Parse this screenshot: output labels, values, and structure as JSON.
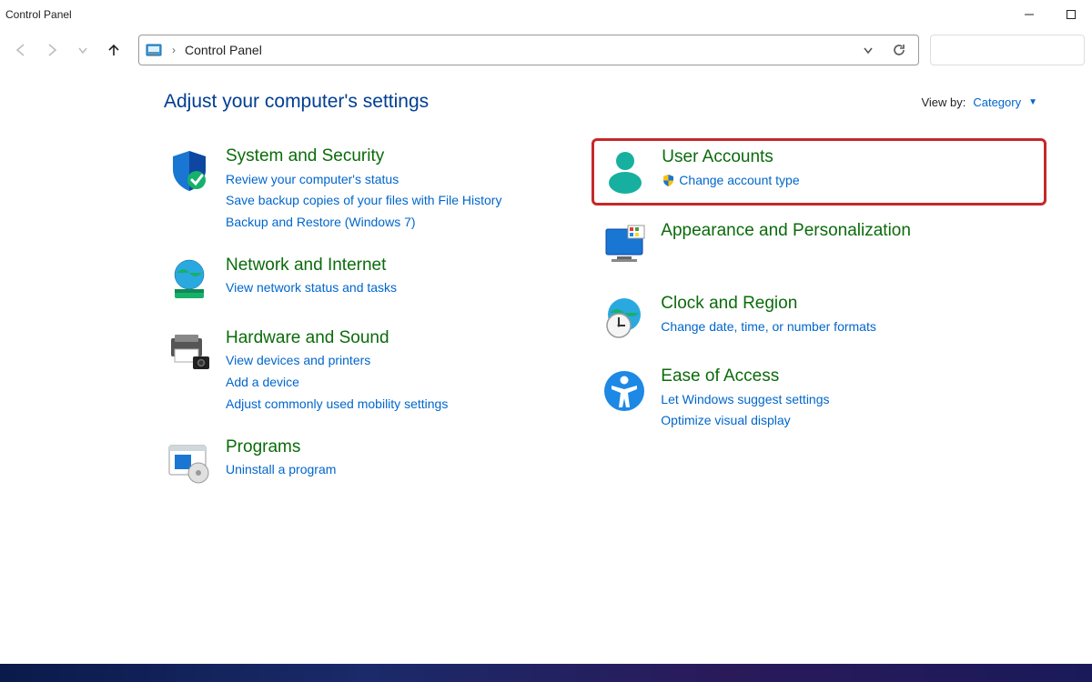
{
  "window": {
    "title": "Control Panel"
  },
  "breadcrumb": {
    "root": "Control Panel"
  },
  "heading": "Adjust your computer's settings",
  "viewby": {
    "label": "View by:",
    "value": "Category"
  },
  "cats": {
    "system": {
      "title": "System and Security",
      "links": [
        "Review your computer's status",
        "Save backup copies of your files with File History",
        "Backup and Restore (Windows 7)"
      ]
    },
    "network": {
      "title": "Network and Internet",
      "links": [
        "View network status and tasks"
      ]
    },
    "hardware": {
      "title": "Hardware and Sound",
      "links": [
        "View devices and printers",
        "Add a device",
        "Adjust commonly used mobility settings"
      ]
    },
    "programs": {
      "title": "Programs",
      "links": [
        "Uninstall a program"
      ]
    },
    "user": {
      "title": "User Accounts",
      "links": [
        "Change account type"
      ]
    },
    "appearance": {
      "title": "Appearance and Personalization",
      "links": []
    },
    "clock": {
      "title": "Clock and Region",
      "links": [
        "Change date, time, or number formats"
      ]
    },
    "ease": {
      "title": "Ease of Access",
      "links": [
        "Let Windows suggest settings",
        "Optimize visual display"
      ]
    }
  }
}
